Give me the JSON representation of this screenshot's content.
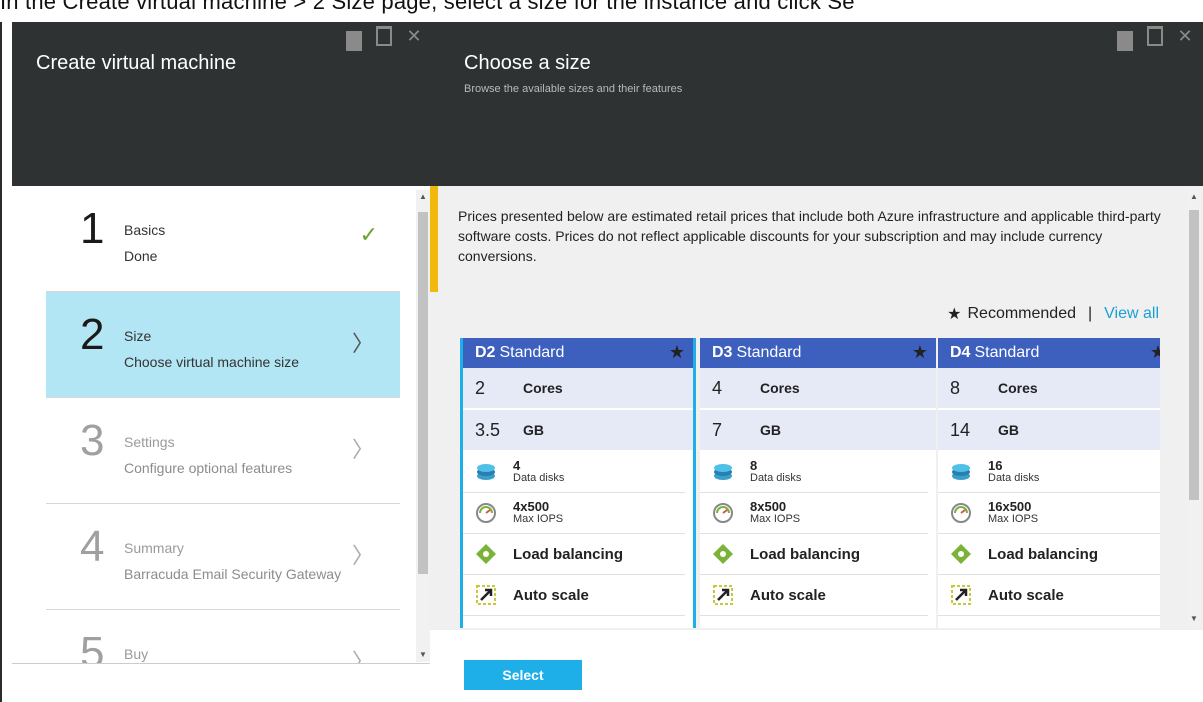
{
  "instruction": {
    "text": "In the Create virtual machine > 2 Size page, select a size for the instance and click Se"
  },
  "left_blade": {
    "title": "Create virtual machine",
    "steps": [
      {
        "num": "1",
        "title": "Basics",
        "desc": "Done",
        "state": "done"
      },
      {
        "num": "2",
        "title": "Size",
        "desc": "Choose virtual machine size",
        "state": "active"
      },
      {
        "num": "3",
        "title": "Settings",
        "desc": "Configure optional features",
        "state": "disabled"
      },
      {
        "num": "4",
        "title": "Summary",
        "desc": "Barracuda Email Security Gateway",
        "state": "disabled"
      },
      {
        "num": "5",
        "title": "Buy",
        "desc": "",
        "state": "disabled"
      }
    ]
  },
  "right_blade": {
    "title": "Choose a size",
    "subtitle": "Browse the available sizes and their features",
    "info": "Prices presented below are estimated retail prices that include both Azure infrastructure and applicable third-party software costs. Prices do not reflect applicable discounts for your subscription and may include currency conversions.",
    "recommended_label": "Recommended",
    "separator": "|",
    "view_all": "View all",
    "select_label": "Select",
    "cards": [
      {
        "code": "D2",
        "tier": "Standard",
        "cores": "2",
        "cores_label": "Cores",
        "ram": "3.5",
        "ram_label": "GB",
        "disks": "4",
        "disks_label": "Data disks",
        "iops": "4x500",
        "iops_label": "Max IOPS",
        "lb": "Load balancing",
        "scale": "Auto scale",
        "selected": true
      },
      {
        "code": "D3",
        "tier": "Standard",
        "cores": "4",
        "cores_label": "Cores",
        "ram": "7",
        "ram_label": "GB",
        "disks": "8",
        "disks_label": "Data disks",
        "iops": "8x500",
        "iops_label": "Max IOPS",
        "lb": "Load balancing",
        "scale": "Auto scale",
        "selected": false
      },
      {
        "code": "D4",
        "tier": "Standard",
        "cores": "8",
        "cores_label": "Cores",
        "ram": "14",
        "ram_label": "GB",
        "disks": "16",
        "disks_label": "Data disks",
        "iops": "16x500",
        "iops_label": "Max IOPS",
        "lb": "Load balancing",
        "scale": "Auto scale",
        "selected": false
      }
    ]
  },
  "colors": {
    "header": "#2f3233",
    "active_step": "#b3e6f4",
    "card_header": "#3d5fbe",
    "accent": "#1eaee8",
    "info_bar": "#f2b90d",
    "check": "#6aa32c"
  }
}
